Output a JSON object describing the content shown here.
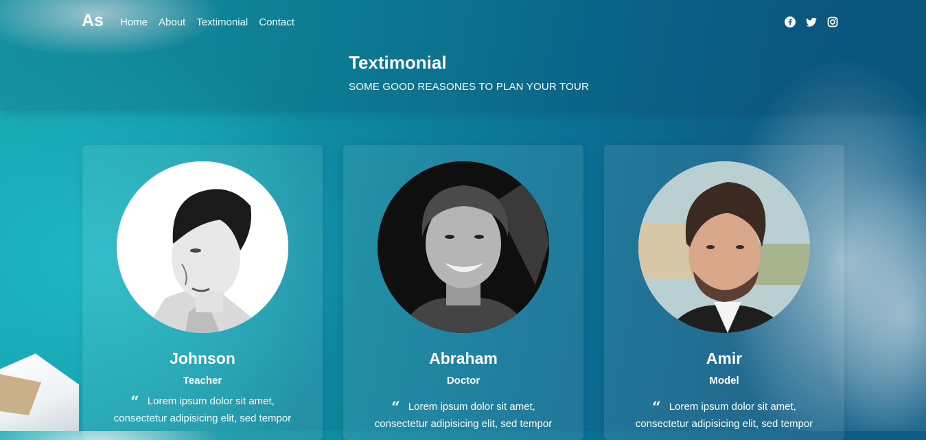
{
  "brand": {
    "logo": "As"
  },
  "nav": {
    "items": [
      "Home",
      "About",
      "Textimonial",
      "Contact"
    ]
  },
  "social": {
    "icons": [
      "facebook-icon",
      "twitter-icon",
      "instagram-icon"
    ]
  },
  "hero": {
    "title": "Textimonial",
    "subtitle": "SOME GOOD REASONES TO PLAN YOUR TOUR"
  },
  "testimonials": [
    {
      "name": "Johnson",
      "role": "Teacher",
      "quote_line1": "Lorem ipsum dolor sit amet,",
      "quote_line2": "consectetur adipisicing elit, sed tempor"
    },
    {
      "name": "Abraham",
      "role": "Doctor",
      "quote_line1": "Lorem ipsum dolor sit amet,",
      "quote_line2": "consectetur adipisicing elit, sed tempor"
    },
    {
      "name": "Amir",
      "role": "Model",
      "quote_line1": "Lorem ipsum dolor sit amet,",
      "quote_line2": "consectetur adipisicing elit, sed tempor"
    }
  ],
  "colors": {
    "text": "#ffffff",
    "sea_light": "#1fb7c3",
    "sea_dark": "#0c5d86"
  }
}
